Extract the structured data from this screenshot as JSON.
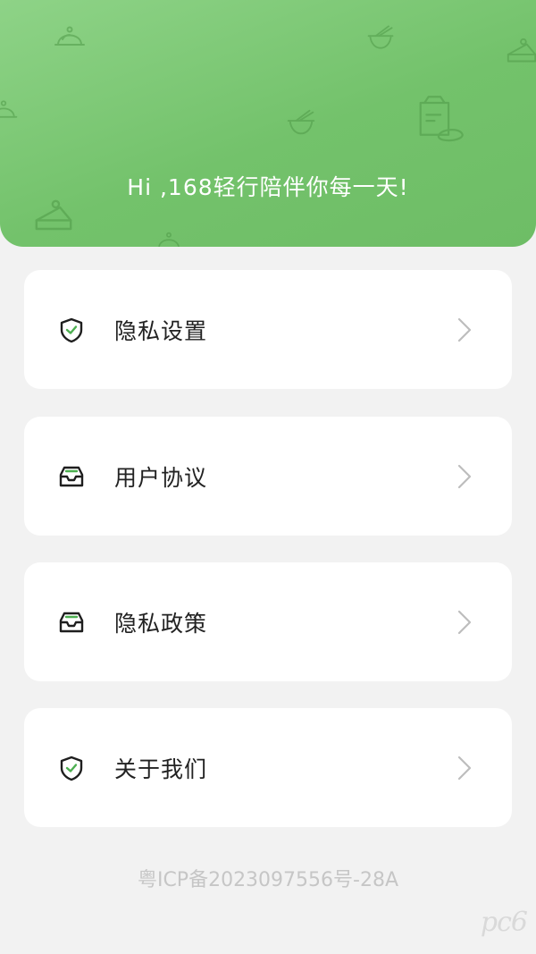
{
  "header": {
    "greeting": "Hi ,168轻行陪伴你每一天!"
  },
  "menu": {
    "items": [
      {
        "label": "隐私设置",
        "icon": "shield-check-icon"
      },
      {
        "label": "用户协议",
        "icon": "inbox-icon"
      },
      {
        "label": "隐私政策",
        "icon": "inbox-icon"
      },
      {
        "label": "关于我们",
        "icon": "shield-check-icon"
      }
    ]
  },
  "footer": {
    "icp": "粤ICP备2023097556号-28A",
    "watermark": "pc6"
  },
  "colors": {
    "header_green": "#77c56f",
    "icon_green": "#4caf50",
    "icon_dark": "#1e1e1e",
    "background": "#f2f2f2",
    "chevron": "#bdbdbd"
  }
}
